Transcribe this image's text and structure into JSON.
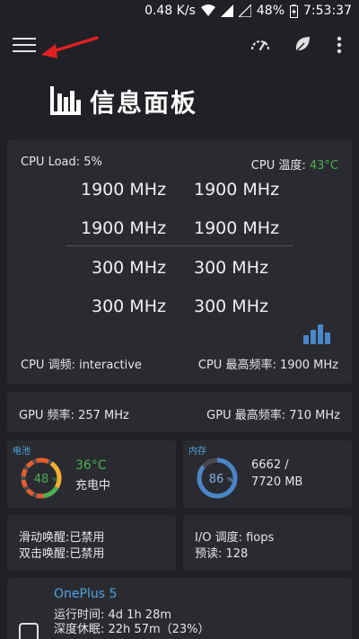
{
  "statusbar": {
    "speed": "0.48 K/s",
    "battery": "48%",
    "time": "7:53:37"
  },
  "header": {
    "title": "信息面板"
  },
  "cpu": {
    "load": "CPU Load: 5%",
    "temp_label": "CPU 温度: ",
    "temp_value": "43°C",
    "freqs": [
      "1900 MHz",
      "1900 MHz",
      "1900 MHz",
      "1900 MHz",
      "300 MHz",
      "300 MHz",
      "300 MHz",
      "300 MHz"
    ],
    "governor": "CPU 调频: interactive",
    "max_freq": "CPU 最高频率: 1900 MHz"
  },
  "gpu": {
    "freq": "GPU 频率: 257 MHz",
    "max": "GPU 最高频率: 710 MHz"
  },
  "battery": {
    "label": "电池",
    "percent": "48",
    "percent_value": 48,
    "temp": "36°C",
    "status": "充电中"
  },
  "memory": {
    "label": "内存",
    "percent": "86",
    "percent_value": 86,
    "used": "6662 /",
    "total": "7720 MB"
  },
  "wake": {
    "swipe": "滑动唤醒:已禁用",
    "double_tap": "双击唤醒:已禁用"
  },
  "io": {
    "scheduler": "I/O 调度: fiops",
    "readahead": "预读: 128"
  },
  "device": {
    "name": "OnePlus 5",
    "uptime": "运行时间:  4d 1h 28m",
    "deep_sleep": "深度休眠:  22h 57m（23%）"
  },
  "colors": {
    "background": "#202126",
    "card": "#2a2b31",
    "accent_blue": "#4fa3e3",
    "accent_green": "#4caf50",
    "arrow_red": "#e02020"
  },
  "icons": [
    "menu-icon",
    "speedometer-icon",
    "leaf-icon",
    "more-vert-icon",
    "bar-chart-icon",
    "phone-icon"
  ]
}
